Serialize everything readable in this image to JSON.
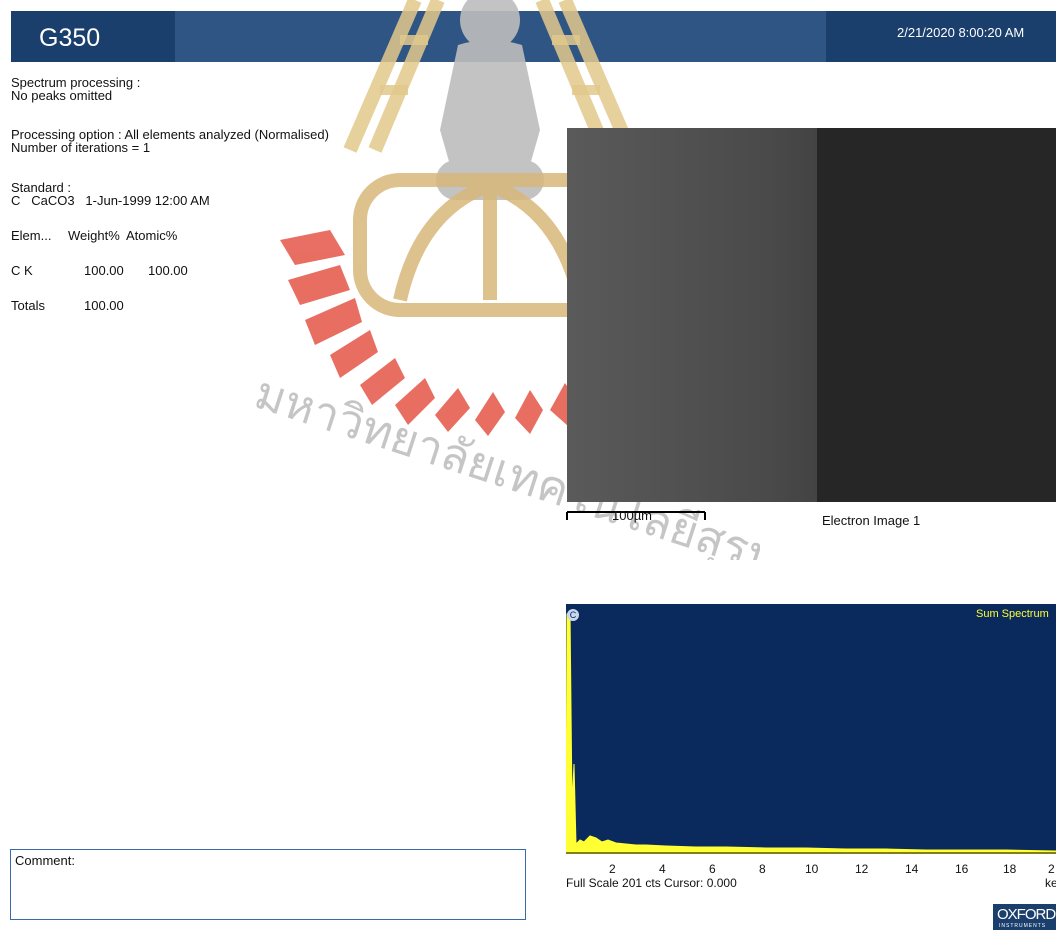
{
  "header": {
    "title": "G350",
    "datetime": "2/21/2020 8:00:20 AM"
  },
  "left_panel": {
    "spectrum_processing_label": "Spectrum processing :",
    "spectrum_processing_value": "No peaks omitted",
    "processing_option": "Processing option : All elements analyzed (Normalised)",
    "iterations": "Number of iterations = 1",
    "standard_label": "Standard :",
    "standard_value": "C   CaCO3   1-Jun-1999 12:00 AM",
    "table": {
      "headers": [
        "Elem...",
        "Weight%",
        "Atomic%"
      ],
      "rows": [
        {
          "elem": "C K",
          "weight": "100.00",
          "atomic": "100.00"
        }
      ],
      "totals_label": "Totals",
      "totals_value": "100.00"
    }
  },
  "electron_image": {
    "scale_label": "100µm",
    "caption": "Electron Image 1"
  },
  "spectrum": {
    "title": "Sum Spectrum",
    "peak_label": "C",
    "x_ticks": [
      "2",
      "4",
      "6",
      "8",
      "10",
      "12",
      "14",
      "16",
      "18",
      "2"
    ],
    "unit": "ke",
    "footer": "Full Scale 201 cts Cursor: 0.000"
  },
  "logo": {
    "text": "OXFORD",
    "sub": "INSTRUMENTS"
  },
  "comment": {
    "label": "Comment:"
  },
  "watermark": {
    "text": "มหาวิทยาลัยเทคโนโลยีสุรนารี"
  },
  "colors": {
    "header_dark": "#1b3f6c",
    "header_mid": "#2e5584",
    "spectrum_bg": "#0a2a5e",
    "spectrum_trace": "#ffff33"
  }
}
